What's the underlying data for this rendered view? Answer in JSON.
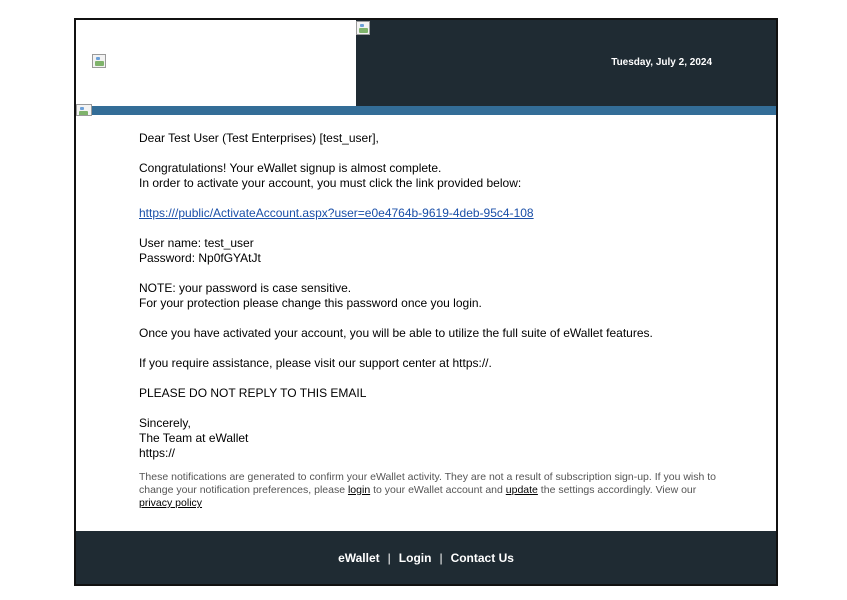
{
  "header": {
    "date": "Tuesday, July 2, 2024"
  },
  "email": {
    "greeting": "Dear Test User (Test Enterprises) [test_user],",
    "intro_line1": "Congratulations! Your eWallet signup is almost complete.",
    "intro_line2": "In order to activate your account, you must click the link provided below:",
    "activation_link": "https:///public/ActivateAccount.aspx?user=e0e4764b-9619-4deb-95c4-108",
    "username_line": "User name: test_user",
    "password_line": "Password: Np0fGYAtJt",
    "note_line1": "NOTE: your password is case sensitive.",
    "note_line2": "For your protection please change this password once you login.",
    "features_line": "Once you have activated your account, you will be able to utilize the full suite of eWallet features.",
    "assistance_line": "If you require assistance, please visit our support center at https://.",
    "no_reply": "PLEASE DO NOT REPLY TO THIS EMAIL",
    "signoff1": "Sincerely,",
    "signoff2": "The Team at eWallet",
    "signoff3": "https://"
  },
  "fineprint": {
    "text1": "These notifications are generated to confirm your eWallet activity. They are not a result of subscription sign-up. If you wish to change your notification preferences, please ",
    "login_link": "login",
    "text2": " to your eWallet account and ",
    "update_link": "update",
    "text3": " the settings accordingly. View our ",
    "privacy_link": "privacy policy"
  },
  "footer": {
    "brand": "eWallet",
    "separator": "|",
    "login": "Login",
    "contact": "Contact Us"
  }
}
